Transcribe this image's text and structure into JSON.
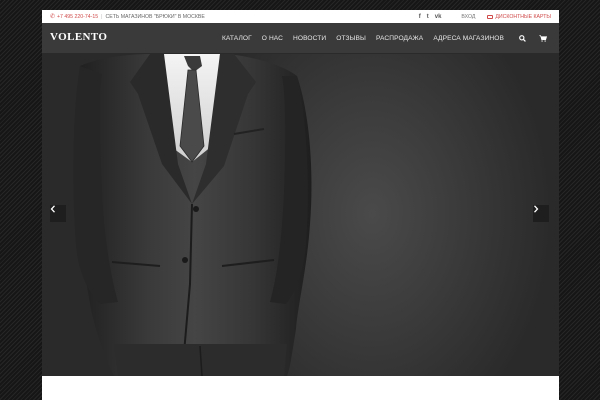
{
  "topbar": {
    "phone": "+7 495 220-74-15",
    "separator": "|",
    "tagline": "СЕТЬ МАГАЗИНОВ \"БРЮКИ\" В МОСКВЕ",
    "social": [
      {
        "name": "facebook-icon",
        "glyph": "f"
      },
      {
        "name": "twitter-icon",
        "glyph": "t"
      },
      {
        "name": "vk-icon",
        "glyph": "vk"
      }
    ],
    "login": "ВХОД",
    "discount_cards": "ДИСКОНТНЫЕ КАРТЫ"
  },
  "header": {
    "logo": "VOLENTO",
    "menu": [
      "КАТАЛОГ",
      "О НАС",
      "НОВОСТИ",
      "ОТЗЫВЫ",
      "РАСПРОДАЖА",
      "АДРЕСА МАГАЗИНОВ"
    ],
    "icons": [
      "search-icon",
      "cart-icon"
    ]
  },
  "hero": {
    "image": "man-in-dark-suit",
    "prev": "previous-slide",
    "next": "next-slide"
  },
  "colors": {
    "accent": "#d04a4a",
    "nav_bg": "#3a3a3a",
    "page_bg": "#1c1c1c"
  }
}
